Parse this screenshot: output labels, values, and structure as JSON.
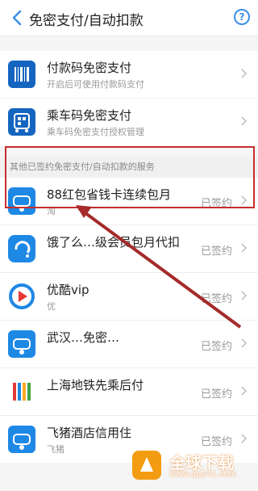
{
  "header": {
    "title": "免密支付/自动扣款",
    "help": "?"
  },
  "top_items": [
    {
      "title": "付款码免密支付",
      "subtitle": "开启后可使用付款码支付",
      "icon": "barcode-icon"
    },
    {
      "title": "乘车码免密支付",
      "subtitle": "乘车码免密支付授权管理",
      "icon": "qr-bus-icon"
    }
  ],
  "group_title": "其他已签约免密支付/自动扣款的服务",
  "services": [
    {
      "title": "88红包省钱卡连续包月",
      "subtitle": "淘",
      "status": "已签约",
      "icon": "shield-icon"
    },
    {
      "title": "饿了么…级会员包月代扣",
      "subtitle": "",
      "status": "已签约",
      "icon": "eleme-icon"
    },
    {
      "title": "优酷vip",
      "subtitle": "优",
      "status": "已签约",
      "icon": "youku-icon"
    },
    {
      "title": "武汉…免密…",
      "subtitle": "",
      "status": "已签约",
      "icon": "shield-icon"
    },
    {
      "title": "上海地铁先乘后付",
      "subtitle": "",
      "status": "已签约",
      "icon": "metro-icon"
    },
    {
      "title": "飞猪酒店信用住",
      "subtitle": "飞猪",
      "status": "已签约",
      "icon": "shield-icon"
    }
  ],
  "watermark": {
    "name": "全球下载",
    "url": "www.qq241.com"
  },
  "colors": {
    "accent": "#1e88e5",
    "highlight": "#c72d2d",
    "arrow": "#a52a2a"
  }
}
